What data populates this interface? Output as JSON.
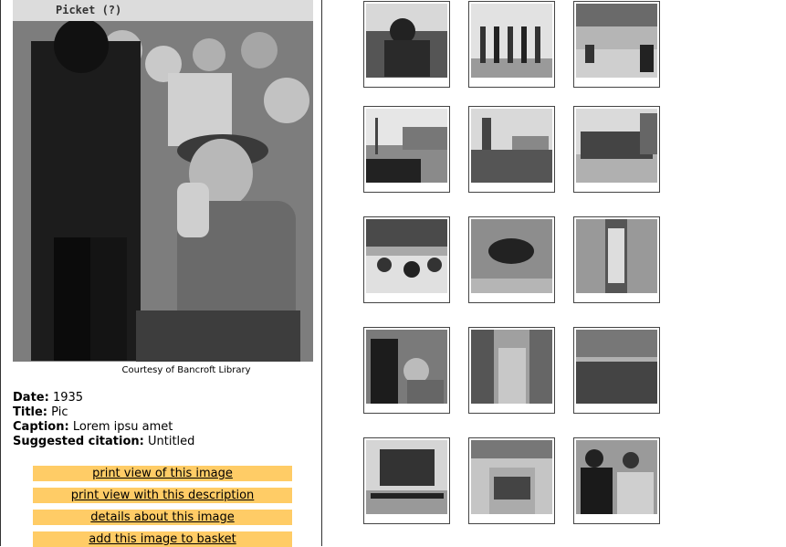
{
  "main_image": {
    "heading": "Picket (?)",
    "credit": "Courtesy of Bancroft Library"
  },
  "details": {
    "date_label": "Date:",
    "date_value": "1935",
    "title_label": "Title:",
    "title_value": "Pic",
    "caption_label": "Caption:",
    "caption_value": "Lorem ipsu amet",
    "citation_label": "Suggested citation:",
    "citation_value": "Untitled"
  },
  "actions": [
    "print view of this image",
    "print view with this description",
    "details about this image",
    "add this image to basket"
  ],
  "thumbnails": [
    {
      "subject": "photographer-with-camera"
    },
    {
      "subject": "group-of-men-standing"
    },
    {
      "subject": "street-scene-horse-rider"
    },
    {
      "subject": "car-at-waterfront"
    },
    {
      "subject": "crowd-at-pier-tower"
    },
    {
      "subject": "police-line-street"
    },
    {
      "subject": "crowd-under-awning"
    },
    {
      "subject": "aerial-crowd-circle"
    },
    {
      "subject": "aerial-street-march"
    },
    {
      "subject": "picket-closeup"
    },
    {
      "subject": "city-street-crowd-aerial"
    },
    {
      "subject": "massive-crowd-buildings"
    },
    {
      "subject": "ship-at-dock-marchers"
    },
    {
      "subject": "march-down-street"
    },
    {
      "subject": "two-men-seated"
    }
  ]
}
